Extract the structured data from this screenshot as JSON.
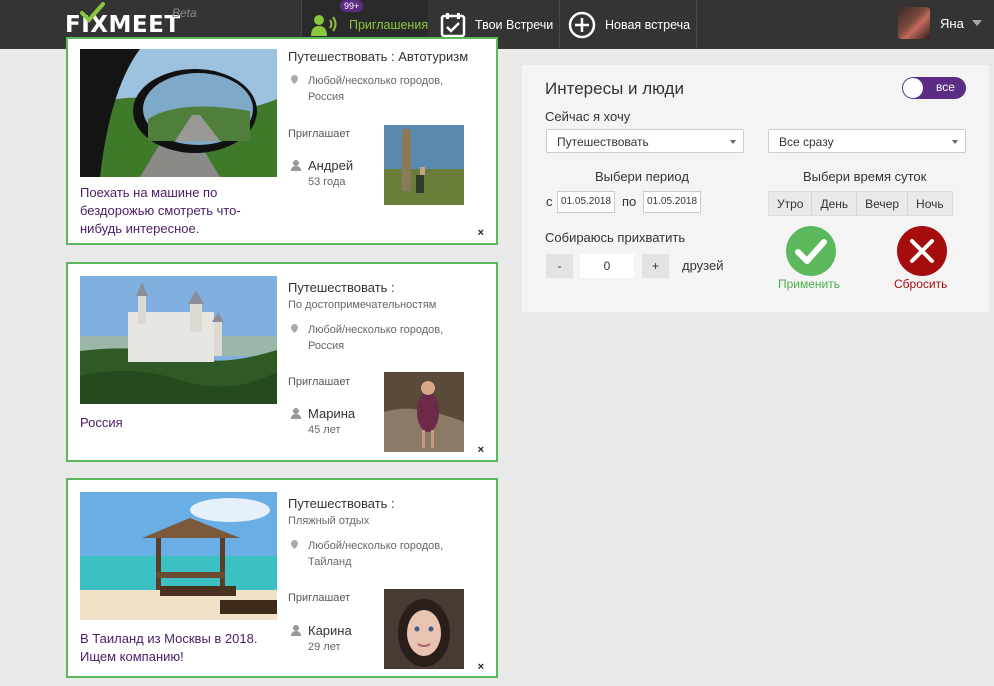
{
  "header": {
    "logo": "FIXMEET",
    "beta": "Beta",
    "nav": {
      "invites": "Приглашения",
      "invites_badge": "99+",
      "meetings": "Твои Встречи",
      "new_meeting": "Новая встреча"
    },
    "user_name": "Яна"
  },
  "cards": [
    {
      "category": "Путешествовать : Автотуризм",
      "location": "Любой/несколько городов, Россия",
      "invites_label": "Приглашает",
      "person_name": "Андрей",
      "person_age": "53 года",
      "description": "Поехать на машине по бездорожью смотреть что-нибудь интересное.",
      "close": "×"
    },
    {
      "category": "Путешествовать :",
      "subcategory": "По достопримечательностям",
      "location": "Любой/несколько городов, Россия",
      "invites_label": "Приглашает",
      "person_name": "Марина",
      "person_age": "45 лет",
      "description": "Россия",
      "close": "×"
    },
    {
      "category": "Путешествовать :",
      "subcategory": "Пляжный отдых",
      "location": "Любой/несколько городов, Тайланд",
      "invites_label": "Приглашает",
      "person_name": "Карина",
      "person_age": "29 лет",
      "description": "В Таиланд из Москвы в 2018. Ищем компанию!",
      "close": "×"
    }
  ],
  "filter": {
    "title": "Интересы и люди",
    "toggle_label": "все",
    "want_label": "Сейчас я хочу",
    "activity_select": "Путешествовать",
    "when_select": "Все сразу",
    "period_label": "Выбери период",
    "from_label": "с",
    "from_date": "01.05.2018",
    "to_label": "по",
    "to_date": "01.05.2018",
    "time_label": "Выбери время суток",
    "time_options": [
      "Утро",
      "День",
      "Вечер",
      "Ночь"
    ],
    "bring_label": "Собираюсь прихватить",
    "minus": "-",
    "count": "0",
    "plus": "+",
    "friends_label": "друзей",
    "apply_label": "Применить",
    "reset_label": "Сбросить"
  },
  "colors": {
    "topbar": "#343434",
    "accent_green": "#8cc63f",
    "card_border": "#5cb85c",
    "purple": "#5b2c83",
    "apply": "#5cb85c",
    "reset": "#a50d0d"
  }
}
